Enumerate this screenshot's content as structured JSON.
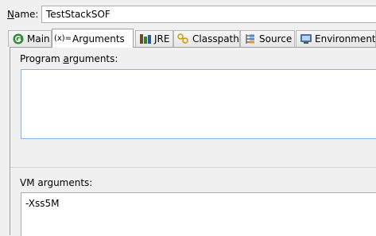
{
  "name_row": {
    "label_prefix": "N",
    "label_rest": "ame:",
    "value": "TestStackSOF"
  },
  "tabs": [
    {
      "label": "Main",
      "icon": "main-icon",
      "active": false
    },
    {
      "label": "Arguments",
      "icon": "arguments-icon",
      "active": true
    },
    {
      "label": "JRE",
      "icon": "jre-icon",
      "active": false
    },
    {
      "label": "Classpath",
      "icon": "classpath-icon",
      "active": false
    },
    {
      "label": "Source",
      "icon": "source-icon",
      "active": false
    },
    {
      "label": "Environment",
      "icon": "environment-icon",
      "active": false
    }
  ],
  "program_arguments": {
    "label_pre": "Program ",
    "label_u": "a",
    "label_post": "rguments:",
    "value": ""
  },
  "vm_arguments": {
    "label": "VM arguments:",
    "value": "-Xss5M"
  }
}
